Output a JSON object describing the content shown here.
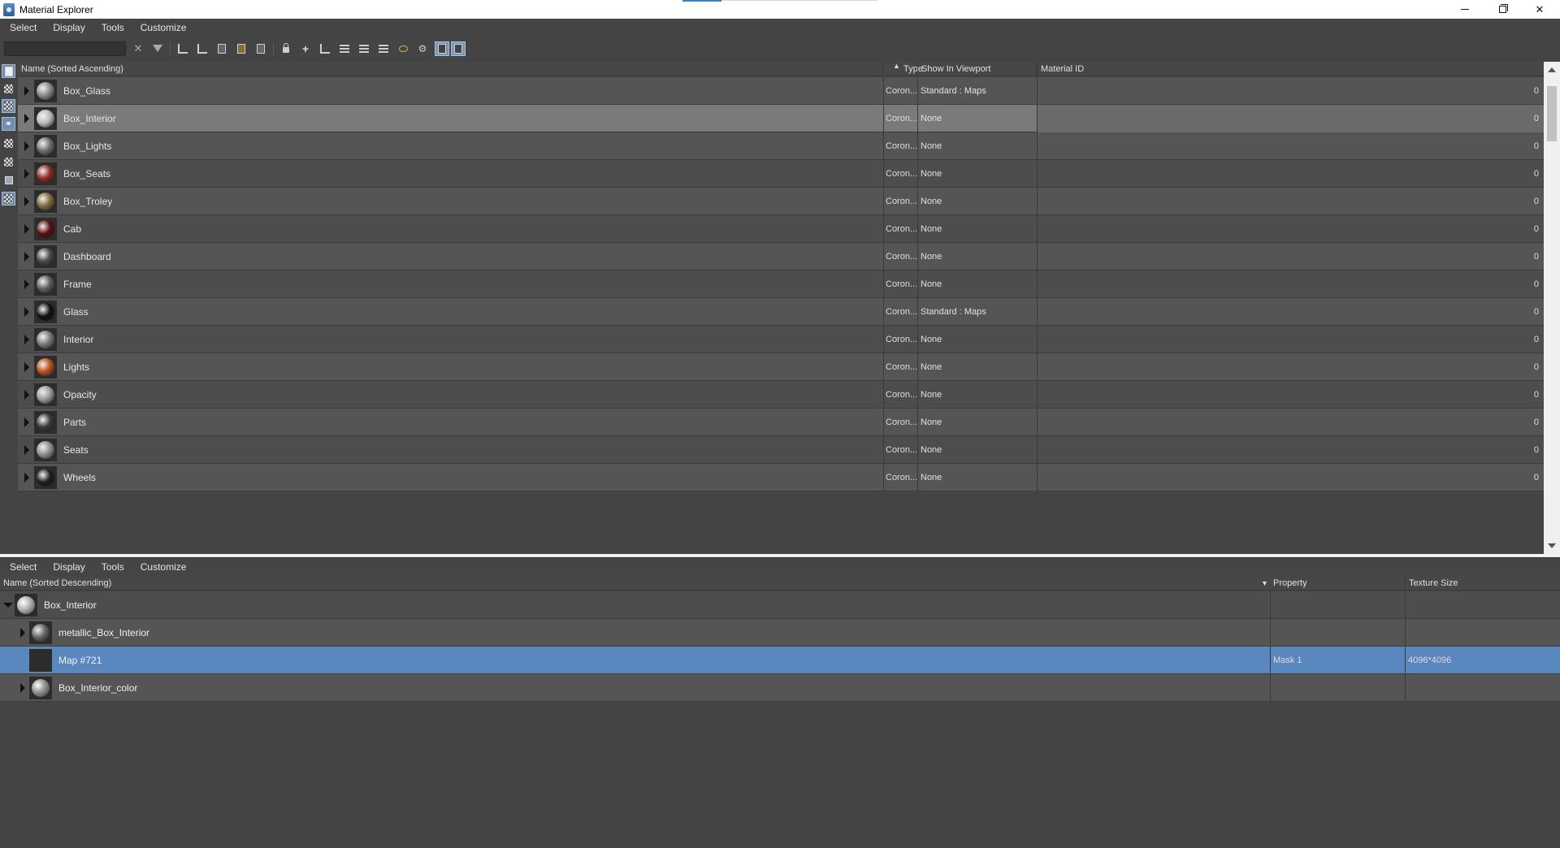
{
  "window": {
    "title": "Material Explorer"
  },
  "top_menu": [
    "Select",
    "Display",
    "Tools",
    "Customize"
  ],
  "search": {
    "value": "",
    "placeholder": ""
  },
  "toolbar_icons": [
    "clear-search-icon",
    "filter-icon",
    "tree-expand-icon",
    "tree-collapse-icon",
    "display-material-icon",
    "display-maps-icon",
    "display-objects-icon",
    "lock-icon",
    "add-icon",
    "hierarchy-icon",
    "layers-icon",
    "stack-icon",
    "view-icon",
    "options-icon",
    "display-grid-icon",
    "display-grid-alt-icon"
  ],
  "top_table": {
    "columns": {
      "name": "Name (Sorted Ascending)",
      "type": "Type",
      "viewport": "Show In Viewport",
      "material_id": "Material ID"
    },
    "rows": [
      {
        "name": "Box_Glass",
        "type": "Coron...",
        "viewport": "Standard : Maps",
        "material_id": "0",
        "color": "#8a8a8a"
      },
      {
        "name": "Box_Interior",
        "type": "Coron...",
        "viewport": "None",
        "material_id": "0",
        "color": "#b9b9b9"
      },
      {
        "name": "Box_Lights",
        "type": "Coron...",
        "viewport": "None",
        "material_id": "0",
        "color": "#6f6f6f"
      },
      {
        "name": "Box_Seats",
        "type": "Coron...",
        "viewport": "None",
        "material_id": "0",
        "color": "#8c2a22"
      },
      {
        "name": "Box_Troley",
        "type": "Coron...",
        "viewport": "None",
        "material_id": "0",
        "color": "#7d6a3c"
      },
      {
        "name": "Cab",
        "type": "Coron...",
        "viewport": "None",
        "material_id": "0",
        "color": "#5a1010"
      },
      {
        "name": "Dashboard",
        "type": "Coron...",
        "viewport": "None",
        "material_id": "0",
        "color": "#4a4a4a"
      },
      {
        "name": "Frame",
        "type": "Coron...",
        "viewport": "None",
        "material_id": "0",
        "color": "#5e5e5e"
      },
      {
        "name": "Glass",
        "type": "Coron...",
        "viewport": "Standard : Maps",
        "material_id": "0",
        "color": "#111111"
      },
      {
        "name": "Interior",
        "type": "Coron...",
        "viewport": "None",
        "material_id": "0",
        "color": "#7a7a7a"
      },
      {
        "name": "Lights",
        "type": "Coron...",
        "viewport": "None",
        "material_id": "0",
        "color": "#b8501c"
      },
      {
        "name": "Opacity",
        "type": "Coron...",
        "viewport": "None",
        "material_id": "0",
        "color": "#9a9a9a"
      },
      {
        "name": "Parts",
        "type": "Coron...",
        "viewport": "None",
        "material_id": "0",
        "color": "#3c3c3c"
      },
      {
        "name": "Seats",
        "type": "Coron...",
        "viewport": "None",
        "material_id": "0",
        "color": "#8e8e8e"
      },
      {
        "name": "Wheels",
        "type": "Coron...",
        "viewport": "None",
        "material_id": "0",
        "color": "#1e1e1e"
      }
    ],
    "selected_row": "Box_Interior"
  },
  "bottom_menu": [
    "Select",
    "Display",
    "Tools",
    "Customize"
  ],
  "bottom_table": {
    "columns": {
      "name": "Name (Sorted Descending)",
      "property": "Property",
      "texture_size": "Texture Size"
    },
    "rows": [
      {
        "name": "Box_Interior",
        "property": "",
        "texture_size": "",
        "level": 0,
        "expanded": true
      },
      {
        "name": "metallic_Box_Interior",
        "property": "",
        "texture_size": "",
        "level": 1,
        "expanded": false
      },
      {
        "name": "Map #721",
        "property": "Mask 1",
        "texture_size": "4096*4096",
        "level": 1,
        "expanded": null
      },
      {
        "name": "Box_Interior_color",
        "property": "",
        "texture_size": "",
        "level": 1,
        "expanded": false
      }
    ],
    "selected_row": "Map #721"
  },
  "colors": {
    "selection_blue": "#5b87bf",
    "selected_gray": "#7a7a7a",
    "panel_bg": "#444444"
  }
}
